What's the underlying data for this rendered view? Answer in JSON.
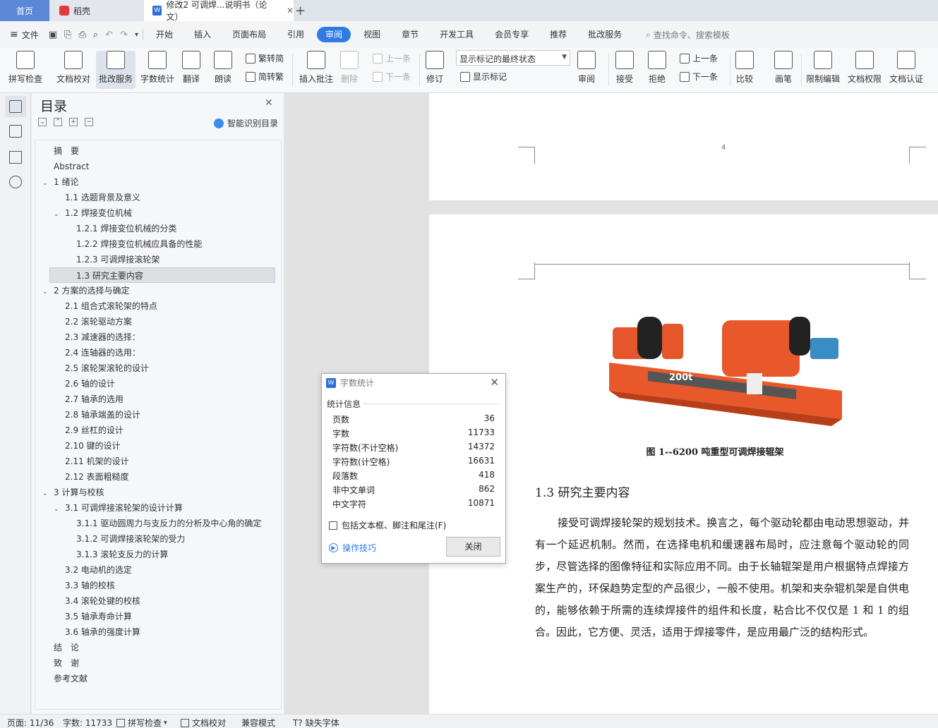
{
  "tabs": {
    "home": "首页",
    "daoke": "稻壳",
    "doc": "修改2 可调焊...说明书（论文）"
  },
  "menu": {
    "file": "文件",
    "items": [
      "开始",
      "插入",
      "页面布局",
      "引用",
      "审阅",
      "视图",
      "章节",
      "开发工具",
      "会员专享",
      "推荐",
      "批改服务"
    ],
    "active": "审阅",
    "search": "查找命令、搜索模板"
  },
  "ribbon": {
    "spellcheck": "拼写检查",
    "proofread": "文档校对",
    "correction_service": "批改服务",
    "word_count": "字数统计",
    "translate": "翻译",
    "read_aloud": "朗读",
    "trad": "繁转简",
    "simp": "简转繁",
    "insert_comment": "插入批注",
    "delete": "删除",
    "prev": "上一条",
    "next": "下一条",
    "revise": "修订",
    "markup_select": "显示标记的最终状态",
    "show_markup": "显示标记",
    "review": "审阅",
    "accept": "接受",
    "reject": "拒绝",
    "prev2": "上一条",
    "next2": "下一条",
    "compare": "比较",
    "pen": "画笔",
    "restrict_edit": "限制编辑",
    "doc_perm": "文档权限",
    "doc_cert": "文档认证"
  },
  "toc": {
    "title": "目录",
    "smart": "智能识别目录",
    "items": [
      {
        "level": 0,
        "text": "摘　要",
        "arrow": false
      },
      {
        "level": 0,
        "text": "Abstract",
        "arrow": false
      },
      {
        "level": 0,
        "text": "1  绪论",
        "arrow": true
      },
      {
        "level": 1,
        "text": "1.1 选题背景及意义",
        "arrow": false
      },
      {
        "level": 1,
        "text": "1.2 焊接变位机械",
        "arrow": true
      },
      {
        "level": 2,
        "text": "1.2.1 焊接变位机械的分类",
        "arrow": false
      },
      {
        "level": 2,
        "text": "1.2.2 焊接变位机械应具备的性能",
        "arrow": false
      },
      {
        "level": 2,
        "text": "1.2.3 可调焊接滚轮架",
        "arrow": false
      },
      {
        "level": 1,
        "text": "1.3  研究主要内容",
        "arrow": false,
        "selected": true
      },
      {
        "level": 0,
        "text": "2  方案的选择与确定",
        "arrow": true
      },
      {
        "level": 1,
        "text": "2.1 组合式滚轮架的特点",
        "arrow": false
      },
      {
        "level": 1,
        "text": "2.2 滚轮驱动方案",
        "arrow": false
      },
      {
        "level": 1,
        "text": "2.3 减速器的选择：",
        "arrow": false
      },
      {
        "level": 1,
        "text": "2.4 连轴器的选用：",
        "arrow": false
      },
      {
        "level": 1,
        "text": "2.5 滚轮架滚轮的设计",
        "arrow": false
      },
      {
        "level": 1,
        "text": "2.6 轴的设计",
        "arrow": false
      },
      {
        "level": 1,
        "text": "2.7 轴承的选用",
        "arrow": false
      },
      {
        "level": 1,
        "text": "2.8 轴承端盖的设计",
        "arrow": false
      },
      {
        "level": 1,
        "text": "2.9 丝杠的设计",
        "arrow": false
      },
      {
        "level": 1,
        "text": "2.10 键的设计",
        "arrow": false
      },
      {
        "level": 1,
        "text": "2.11 机架的设计",
        "arrow": false
      },
      {
        "level": 1,
        "text": "2.12 表面粗糙度",
        "arrow": false
      },
      {
        "level": 0,
        "text": "3  计算与校核",
        "arrow": true
      },
      {
        "level": 1,
        "text": "3.1 可调焊接滚轮架的设计计算",
        "arrow": true
      },
      {
        "level": 2,
        "text": "3.1.1 驱动圆周力与支反力的分析及中心角的确定",
        "arrow": false
      },
      {
        "level": 2,
        "text": "3.1.2  可调焊接滚轮架的受力",
        "arrow": false
      },
      {
        "level": 2,
        "text": "3.1.3 滚轮支反力的计算",
        "arrow": false
      },
      {
        "level": 1,
        "text": "3.2 电动机的选定",
        "arrow": false
      },
      {
        "level": 1,
        "text": "3.3 轴的校核",
        "arrow": false
      },
      {
        "level": 1,
        "text": "3.4 滚轮处键的校核",
        "arrow": false
      },
      {
        "level": 1,
        "text": "3.5 轴承寿命计算",
        "arrow": false
      },
      {
        "level": 1,
        "text": "3.6 轴承的强度计算",
        "arrow": false
      },
      {
        "level": 0,
        "text": "结　论",
        "arrow": false
      },
      {
        "level": 0,
        "text": "致　谢",
        "arrow": false
      },
      {
        "level": 0,
        "text": "参考文献",
        "arrow": false
      }
    ]
  },
  "document": {
    "page_number": "4",
    "figure_caption": "图 1--6200 吨重型可调焊接辊架",
    "figure_text": "200t",
    "section_heading": "1.3  研究主要内容",
    "paragraph": "接受可调焊接轮架的规划技术。换言之，每个驱动轮都由电动思想驱动，并有一个延迟机制。然而，在选择电机和缓速器布局时，应注意每个驱动轮的同步，尽管选择的图像特征和实际应用不同。由于长轴辊架是用户根据特点焊接方案生产的，环保趋势定型的产品很少，一般不使用。机架和夹杂辊机架是自供电的，能够依赖于所需的连续焊接件的组件和长度，粘合比不仅仅是 1 和 1 的组合。因此，它方便、灵活，适用于焊接零件，是应用最广泛的结构形式。"
  },
  "dialog": {
    "title": "字数统计",
    "group": "统计信息",
    "rows": [
      {
        "label": "页数",
        "value": "36"
      },
      {
        "label": "字数",
        "value": "11733"
      },
      {
        "label": "字符数(不计空格)",
        "value": "14372"
      },
      {
        "label": "字符数(计空格)",
        "value": "16631"
      },
      {
        "label": "段落数",
        "value": "418"
      },
      {
        "label": "非中文单词",
        "value": "862"
      },
      {
        "label": "中文字符",
        "value": "10871"
      }
    ],
    "checkbox": "包括文本框、脚注和尾注(F)",
    "tips": "操作技巧",
    "close": "关闭"
  },
  "status": {
    "page": "页面: 11/36",
    "words": "字数: 11733",
    "spell": "拼写检查",
    "proof": "文档校对",
    "compat": "兼容模式",
    "font_missing": "缺失字体"
  }
}
